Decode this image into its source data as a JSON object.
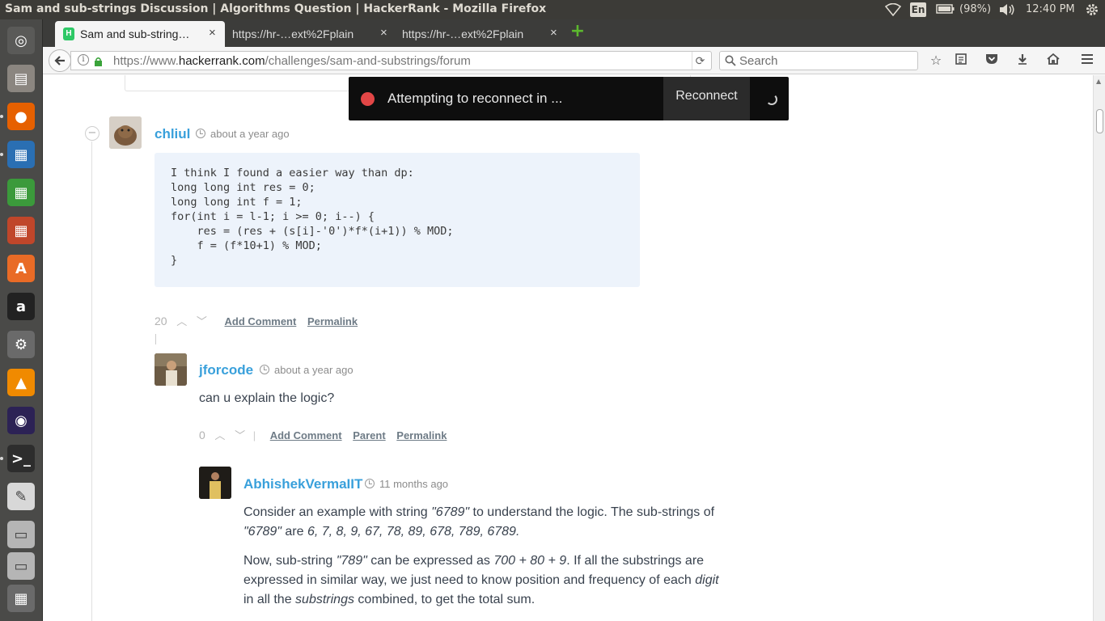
{
  "window": {
    "title": "Sam and sub-strings Discussion | Algorithms Question | HackerRank - Mozilla Firefox"
  },
  "tray": {
    "language": "En",
    "battery": "(98%)",
    "time": "12:40 PM",
    "icons": [
      "wifi-icon",
      "keyboard-icon",
      "battery-icon",
      "volume-icon",
      "gear-icon"
    ]
  },
  "launcher": {
    "items": [
      {
        "name": "ubuntu-dash-icon",
        "color": "#5a5a58"
      },
      {
        "name": "files-icon",
        "color": "#8b8680"
      },
      {
        "name": "firefox-icon",
        "color": "#e66000"
      },
      {
        "name": "libreoffice-writer-icon",
        "color": "#2a6fb3"
      },
      {
        "name": "libreoffice-calc-icon",
        "color": "#3b9a3b"
      },
      {
        "name": "libreoffice-impress-icon",
        "color": "#c0462a"
      },
      {
        "name": "software-center-icon",
        "color": "#e96b26"
      },
      {
        "name": "amazon-icon",
        "color": "#222222"
      },
      {
        "name": "system-settings-icon",
        "color": "#6a6a6a"
      },
      {
        "name": "vlc-icon",
        "color": "#f08a00"
      },
      {
        "name": "eclipse-icon",
        "color": "#2c2255"
      },
      {
        "name": "terminal-icon",
        "color": "#2d2d2d"
      },
      {
        "name": "text-editor-icon",
        "color": "#d8d8d8"
      },
      {
        "name": "drive-icon",
        "color": "#b5b5b5"
      },
      {
        "name": "drive-2-icon",
        "color": "#b5b5b5"
      },
      {
        "name": "workspace-switcher-icon",
        "color": "#6a6a6a"
      }
    ]
  },
  "tabs": [
    {
      "label": "Sam and sub-string…",
      "close": "×"
    },
    {
      "label": "https://hr-…ext%2Fplain",
      "close": "×"
    },
    {
      "label": "https://hr-…ext%2Fplain",
      "close": "×"
    }
  ],
  "navbar": {
    "url_prefix": "https://www.",
    "url_domain": "hackerrank.com",
    "url_path": "/challenges/sam-and-substrings/forum",
    "search_placeholder": "Search"
  },
  "reconnect": {
    "message": "Attempting to reconnect in ...",
    "button": "Reconnect"
  },
  "comments": [
    {
      "user": "chliul",
      "time": "about a year ago",
      "code": "I think I found a easier way than dp:\nlong long int res = 0;\nlong long int f = 1;\nfor(int i = l-1; i >= 0; i--) {\n    res = (res + (s[i]-'0')*f*(i+1)) % MOD;\n    f = (f*10+1) % MOD;\n}",
      "votes": "20",
      "add_comment": "Add Comment",
      "permalink": "Permalink"
    },
    {
      "user": "jforcode",
      "time": "about a year ago",
      "text": "can u explain the logic?",
      "votes": "0",
      "add_comment": "Add Comment",
      "parent": "Parent",
      "permalink": "Permalink"
    },
    {
      "user": "AbhishekVermaIIT",
      "time": "11 months ago",
      "p1_a": "Consider an example with string ",
      "p1_b": "\"6789\"",
      "p1_c": " to understand the logic. The sub-strings of ",
      "p1_d": "\"6789\"",
      "p1_e": " are ",
      "p1_f": "6, 7, 8, 9, 67, 78, 89, 678, 789, 6789.",
      "p2_a": "Now, sub-string ",
      "p2_b": "\"789\"",
      "p2_c": " can be expressed as ",
      "p2_d": "700 + 80 + 9",
      "p2_e": ". If all the substrings are expressed in similar way, we just need to know position and frequency of each ",
      "p2_f": "digit",
      "p2_g": " in all the ",
      "p2_h": "substrings",
      "p2_i": " combined, to get the total sum."
    }
  ],
  "collapse_symbol": "−"
}
